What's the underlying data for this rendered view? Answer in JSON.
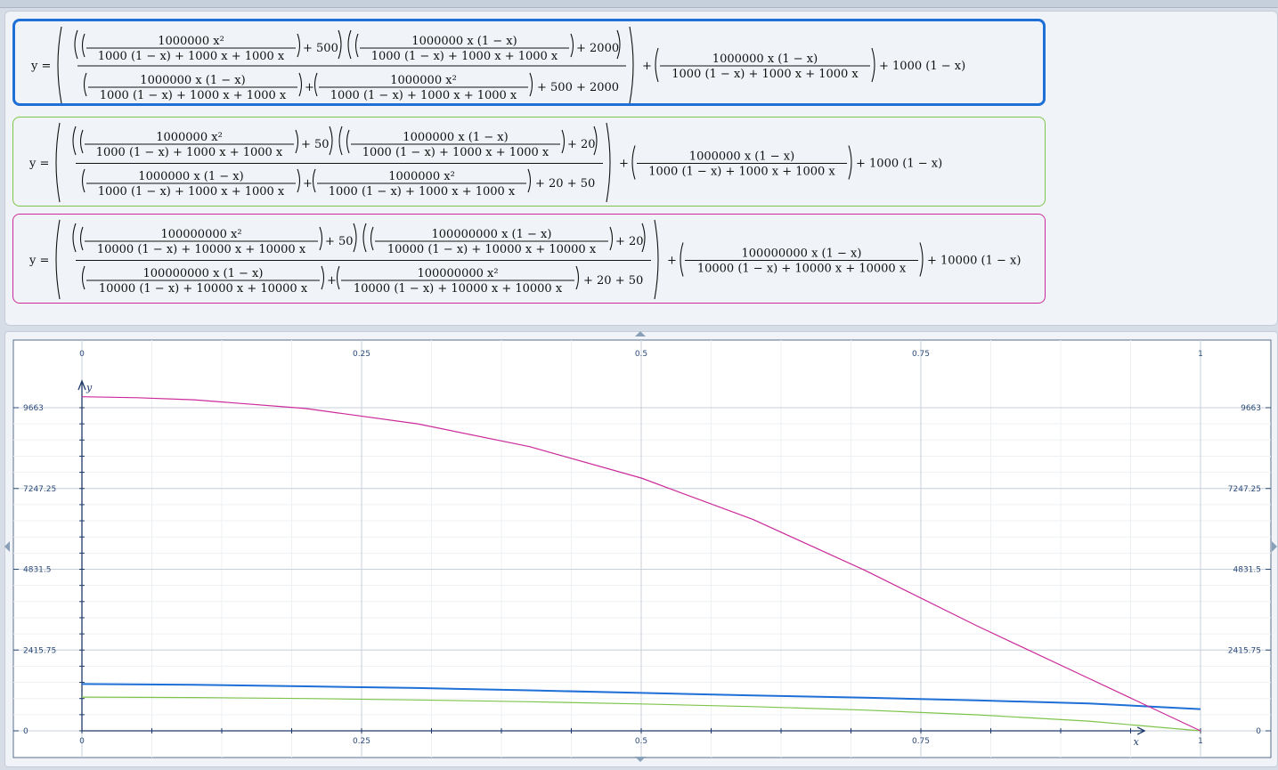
{
  "formulas": [
    {
      "id": "blue",
      "color": "#1e6fd6",
      "lead": "y =",
      "num1_top": "1000000 x²",
      "num1_bot": "1000 (1 − x) + 1000 x + 1000 x",
      "c1": "+ 500",
      "num2_top": "1000000 x (1 − x)",
      "num2_bot": "1000 (1 − x) + 1000 x + 1000 x",
      "c2": "+ 2000",
      "den1_top": "1000000 x (1 − x)",
      "den1_bot": "1000 (1 − x) + 1000 x + 1000 x",
      "den2_top": "1000000 x²",
      "den2_bot": "1000 (1 − x) + 1000 x + 1000 x",
      "den_tail": "+ 500 + 2000",
      "plus": "+",
      "right_top": "1000000 x (1 − x)",
      "right_bot": "1000 (1 − x) + 1000 x + 1000 x",
      "tail": "+ 1000 (1 − x)"
    },
    {
      "id": "green",
      "color": "#7ec44a",
      "lead": "y =",
      "num1_top": "1000000 x²",
      "num1_bot": "1000 (1 − x) + 1000 x + 1000 x",
      "c1": "+ 50",
      "num2_top": "1000000 x (1 − x)",
      "num2_bot": "1000 (1 − x) + 1000 x + 1000 x",
      "c2": "+ 20",
      "den1_top": "1000000 x (1 − x)",
      "den1_bot": "1000 (1 − x) + 1000 x + 1000 x",
      "den2_top": "1000000 x²",
      "den2_bot": "1000 (1 − x) + 1000 x + 1000 x",
      "den_tail": "+ 20 + 50",
      "plus": "+",
      "right_top": "1000000 x (1 − x)",
      "right_bot": "1000 (1 − x) + 1000 x + 1000 x",
      "tail": "+ 1000 (1 − x)"
    },
    {
      "id": "magenta",
      "color": "#cc2a9a",
      "lead": "y =",
      "num1_top": "100000000 x²",
      "num1_bot": "10000 (1 − x) + 10000 x + 10000 x",
      "c1": "+ 50",
      "num2_top": "100000000 x (1 − x)",
      "num2_bot": "10000 (1 − x) + 10000 x + 10000 x",
      "c2": "+ 20",
      "den1_top": "100000000 x (1 − x)",
      "den1_bot": "10000 (1 − x) + 10000 x + 10000 x",
      "den2_top": "100000000 x²",
      "den2_bot": "10000 (1 − x) + 10000 x + 10000 x",
      "den_tail": "+ 20 + 50",
      "plus": "+",
      "right_top": "100000000 x (1 − x)",
      "right_bot": "10000 (1 − x) + 10000 x + 10000 x",
      "tail": "+ 10000 (1 − x)"
    }
  ],
  "chart_data": {
    "type": "line",
    "xlabel": "x",
    "ylabel": "y",
    "xlim": [
      0,
      1
    ],
    "ylim": [
      0,
      9663
    ],
    "x_ticks": [
      "0",
      "0.25",
      "0.5",
      "0.75",
      "1"
    ],
    "y_ticks": [
      "0",
      "2415.75",
      "4831.5",
      "7247.25",
      "9663"
    ],
    "x_tick_values": [
      0,
      0.25,
      0.5,
      0.75,
      1
    ],
    "y_tick_values": [
      0,
      2415.75,
      4831.5,
      7247.25,
      9663
    ],
    "grid": true,
    "series": [
      {
        "color": "#1e6fd6",
        "x": [
          0,
          0.1,
          0.2,
          0.3,
          0.4,
          0.5,
          0.6,
          0.7,
          0.8,
          0.9,
          1.0
        ],
        "values": [
          1400,
          1375,
          1330,
          1280,
          1210,
          1135,
          1060,
          990,
          910,
          820,
          650
        ]
      },
      {
        "color": "#7ec44a",
        "x": [
          0,
          0.1,
          0.2,
          0.3,
          0.4,
          0.5,
          0.6,
          0.7,
          0.8,
          0.9,
          1.0
        ],
        "values": [
          1010,
          995,
          965,
          925,
          870,
          805,
          725,
          620,
          480,
          290,
          0
        ]
      },
      {
        "color": "#cc2a9a",
        "x": [
          0,
          0.05,
          0.1,
          0.2,
          0.3,
          0.4,
          0.5,
          0.6,
          0.7,
          0.8,
          0.9,
          1.0
        ],
        "values": [
          9990,
          9960,
          9900,
          9640,
          9180,
          8500,
          7560,
          6320,
          4800,
          3140,
          1570,
          0
        ]
      }
    ]
  }
}
